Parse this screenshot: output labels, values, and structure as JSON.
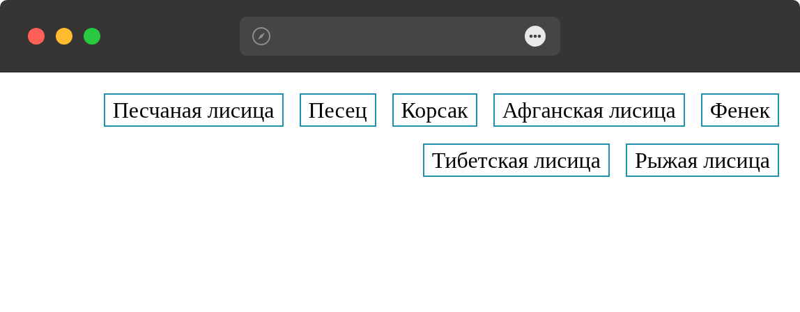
{
  "tags": [
    "Песчаная лисица",
    "Песец",
    "Корсак",
    "Афганская лисица",
    "Фенек",
    "Тибетская лисица",
    "Рыжая лисица"
  ]
}
